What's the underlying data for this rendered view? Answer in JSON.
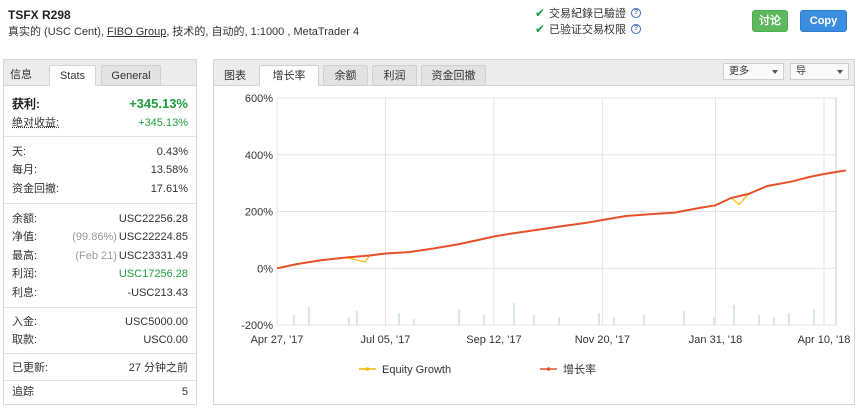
{
  "header": {
    "title": "TSFX R298",
    "subtitle_prefix": "真实的 (USC Cent), ",
    "broker": "FIBO Group",
    "subtitle_suffix": ", 技术的, 自动的, 1:1000 , MetaTrader 4",
    "verify1": "交易紀錄已驗證",
    "verify2": "已验证交易权限",
    "discuss_label": "讨论",
    "copy_label": "Copy"
  },
  "left_tabs": [
    "信息",
    "Stats",
    "General"
  ],
  "stats": {
    "gain_label": "获利:",
    "gain_value": "+345.13%",
    "abs_gain_label": "绝对收益:",
    "abs_gain_value": "+345.13%",
    "daily_label": "天:",
    "daily_value": "0.43%",
    "monthly_label": "每月:",
    "monthly_value": "13.58%",
    "drawdown_label": "资金回撤:",
    "drawdown_value": "17.61%",
    "balance_label": "余额:",
    "balance_value": "USC22256.28",
    "equity_label": "净值:",
    "equity_pre": "(99.86%)",
    "equity_value": "USC22224.85",
    "highest_label": "最高:",
    "highest_pre": "(Feb 21)",
    "highest_value": "USC23331.49",
    "profit_label": "利润:",
    "profit_value": "USC17256.28",
    "interest_label": "利息:",
    "interest_value": "-USC213.43",
    "deposits_label": "入金:",
    "deposits_value": "USC5000.00",
    "withdrawals_label": "取款:",
    "withdrawals_value": "USC0.00",
    "updated_label": "已更新:",
    "updated_value": "27 分钟之前",
    "tracking_label": "追踪",
    "tracking_value": "5"
  },
  "chart_panel": {
    "label": "图表",
    "tabs": [
      "增长率",
      "余额",
      "利润",
      "资金回撤"
    ],
    "more_label": "更多",
    "export_label": "导"
  },
  "colors": {
    "growth": "#e8502a",
    "equity": "#f5b800",
    "deposit_bars": "#b8c8d8",
    "positive": "#1e9e3e"
  },
  "chart_data": {
    "type": "line",
    "y_ticks": [
      "600%",
      "400%",
      "200%",
      "0%",
      "-200%"
    ],
    "ylim": [
      -200,
      600
    ],
    "x_ticks": [
      "Apr 27, '17",
      "Jul 05, '17",
      "Sep 12, '17",
      "Nov 20, '17",
      "Jan 31, '18",
      "Apr 10, '18"
    ],
    "x_tick_dates": [
      "2017-04-27",
      "2017-07-05",
      "2017-09-12",
      "2017-11-20",
      "2018-01-31",
      "2018-04-10"
    ],
    "series": [
      {
        "name": "增长率",
        "x": [
          "2017-04-27",
          "2017-05-10",
          "2017-05-25",
          "2017-06-10",
          "2017-06-25",
          "2017-07-05",
          "2017-07-20",
          "2017-08-05",
          "2017-08-20",
          "2017-09-01",
          "2017-09-12",
          "2017-09-25",
          "2017-10-10",
          "2017-10-25",
          "2017-11-10",
          "2017-11-20",
          "2017-12-05",
          "2017-12-20",
          "2018-01-05",
          "2018-01-20",
          "2018-01-31",
          "2018-02-10",
          "2018-02-21",
          "2018-03-05",
          "2018-03-20",
          "2018-04-01",
          "2018-04-10",
          "2018-04-24"
        ],
        "values": [
          0,
          15,
          28,
          38,
          45,
          52,
          57,
          70,
          84,
          98,
          112,
          124,
          136,
          148,
          160,
          170,
          184,
          190,
          196,
          212,
          222,
          248,
          262,
          290,
          305,
          322,
          332,
          345
        ]
      },
      {
        "name": "Equity Growth",
        "x": [
          "2017-04-27",
          "2017-05-10",
          "2017-05-25",
          "2017-06-10",
          "2017-06-22",
          "2017-06-25",
          "2017-07-05",
          "2017-07-20",
          "2017-08-05",
          "2017-08-20",
          "2017-09-01",
          "2017-09-12",
          "2017-09-25",
          "2017-10-10",
          "2017-10-25",
          "2017-11-10",
          "2017-11-20",
          "2017-12-05",
          "2017-12-20",
          "2018-01-05",
          "2018-01-20",
          "2018-01-31",
          "2018-02-10",
          "2018-02-15",
          "2018-02-21",
          "2018-03-05",
          "2018-03-20",
          "2018-04-01",
          "2018-04-10",
          "2018-04-24"
        ],
        "values": [
          0,
          15,
          28,
          38,
          22,
          45,
          52,
          57,
          70,
          84,
          98,
          112,
          124,
          136,
          148,
          160,
          170,
          184,
          190,
          196,
          212,
          222,
          248,
          225,
          262,
          290,
          305,
          322,
          332,
          345
        ]
      }
    ],
    "legend": [
      "Equity Growth",
      "增长率"
    ]
  }
}
